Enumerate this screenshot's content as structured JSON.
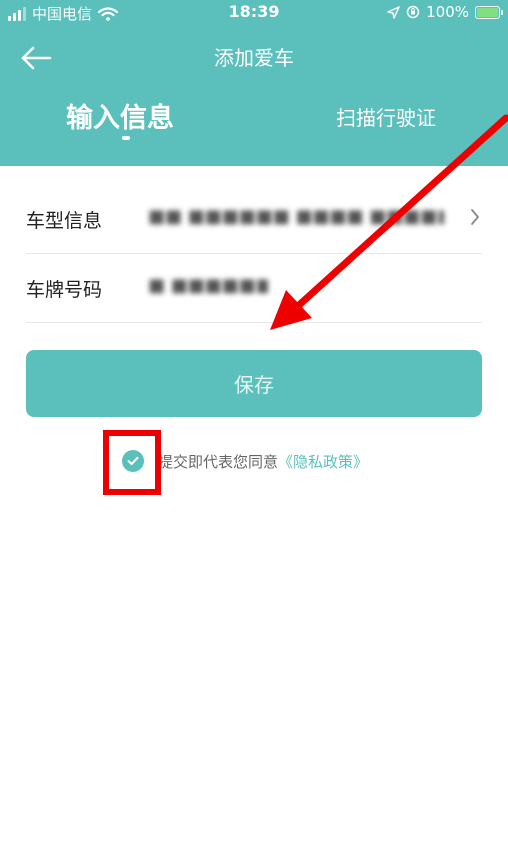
{
  "status_bar": {
    "carrier": "中国电信",
    "time": "18:39",
    "battery": "100%"
  },
  "nav": {
    "title": "添加爱车"
  },
  "tabs": [
    {
      "label": "输入信息",
      "active": true
    },
    {
      "label": "扫描行驶证",
      "active": false
    }
  ],
  "form": {
    "model": {
      "label": "车型信息",
      "value": "■■ ■■■■■■ ■■■■ ■■■■■…"
    },
    "plate": {
      "label": "车牌号码",
      "value": "■ ■■■■■■"
    }
  },
  "save_label": "保存",
  "agreement": {
    "text": "提交即代表您同意",
    "link": "《隐私政策》"
  },
  "colors": {
    "accent": "#5bbfbc",
    "annotation": "#ee0000"
  }
}
